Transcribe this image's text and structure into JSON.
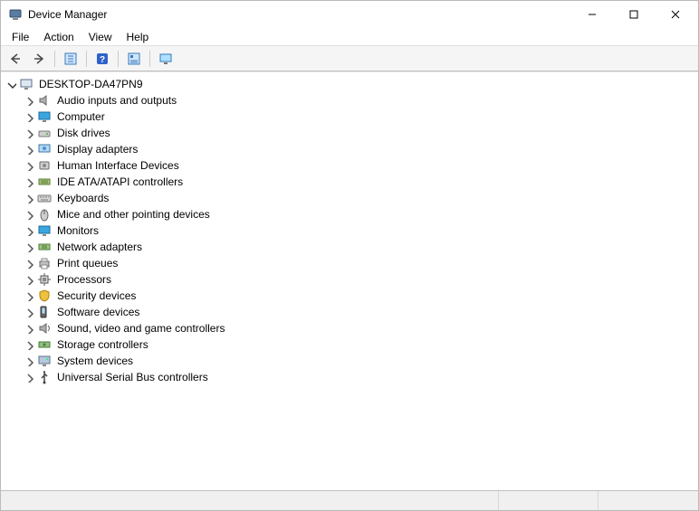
{
  "window": {
    "title": "Device Manager"
  },
  "menu": {
    "items": [
      "File",
      "Action",
      "View",
      "Help"
    ]
  },
  "toolbar": {
    "buttons": [
      {
        "name": "back-icon"
      },
      {
        "name": "forward-icon"
      },
      {
        "name": "sep"
      },
      {
        "name": "show-hide-tree-icon"
      },
      {
        "name": "help-icon"
      },
      {
        "name": "properties-icon"
      },
      {
        "name": "scan-hardware-icon"
      }
    ]
  },
  "tree": {
    "root": {
      "label": "DESKTOP-DA47PN9",
      "icon": "computer-root-icon",
      "expanded": true,
      "children": [
        {
          "label": "Audio inputs and outputs",
          "icon": "audio-icon"
        },
        {
          "label": "Computer",
          "icon": "monitor-icon"
        },
        {
          "label": "Disk drives",
          "icon": "disk-icon"
        },
        {
          "label": "Display adapters",
          "icon": "display-adapter-icon"
        },
        {
          "label": "Human Interface Devices",
          "icon": "hid-icon"
        },
        {
          "label": "IDE ATA/ATAPI controllers",
          "icon": "ide-icon"
        },
        {
          "label": "Keyboards",
          "icon": "keyboard-icon"
        },
        {
          "label": "Mice and other pointing devices",
          "icon": "mouse-icon"
        },
        {
          "label": "Monitors",
          "icon": "monitor-icon"
        },
        {
          "label": "Network adapters",
          "icon": "network-icon"
        },
        {
          "label": "Print queues",
          "icon": "printer-icon"
        },
        {
          "label": "Processors",
          "icon": "cpu-icon"
        },
        {
          "label": "Security devices",
          "icon": "security-icon"
        },
        {
          "label": "Software devices",
          "icon": "software-icon"
        },
        {
          "label": "Sound, video and game controllers",
          "icon": "sound-video-icon"
        },
        {
          "label": "Storage controllers",
          "icon": "storage-icon"
        },
        {
          "label": "System devices",
          "icon": "system-icon"
        },
        {
          "label": "Universal Serial Bus controllers",
          "icon": "usb-icon"
        }
      ]
    }
  }
}
